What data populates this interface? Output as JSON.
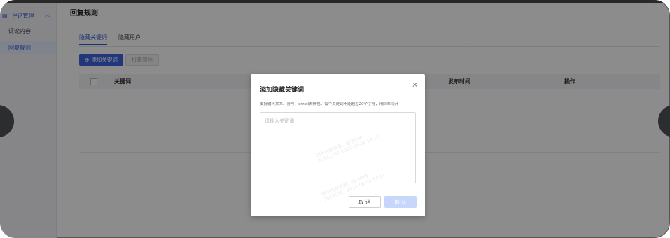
{
  "sidebar": {
    "group": {
      "label": "评论管理",
      "icon": "list-icon",
      "expand_icon": "chevron-up-icon"
    },
    "items": [
      {
        "label": "评论内容",
        "active": false
      },
      {
        "label": "回复规则",
        "active": true
      }
    ]
  },
  "header": {
    "title": "回复规则"
  },
  "tabs": [
    {
      "label": "隐藏关键词",
      "active": true
    },
    {
      "label": "隐藏用户",
      "active": false
    }
  ],
  "toolbar": {
    "add_label": "添加关键词",
    "add_icon": "plus-circle-icon",
    "batch_delete_label": "批量删除"
  },
  "table": {
    "columns": [
      "关键词",
      "发布时间",
      "操作"
    ]
  },
  "modal": {
    "title": "添加隐藏关键词",
    "close_icon": "close-icon",
    "hint": "支持输入文本、符号、emoji表情包，每个关键词不能超过20个字符，用回车间开",
    "input": {
      "placeholder": "请输入关键词",
      "value": ""
    },
    "cancel_label": "取 消",
    "confirm_label": "确 认"
  },
  "watermark": {
    "line1": "快手内部资源，请勿外传",
    "line2": "20231787 2025-06-04 14:17"
  },
  "colors": {
    "accent": "#2d5bd7",
    "primary_button": "#3f63e0",
    "confirm_disabled": "#c6d7fb",
    "overlay": "rgba(0,0,0,0.45)"
  }
}
